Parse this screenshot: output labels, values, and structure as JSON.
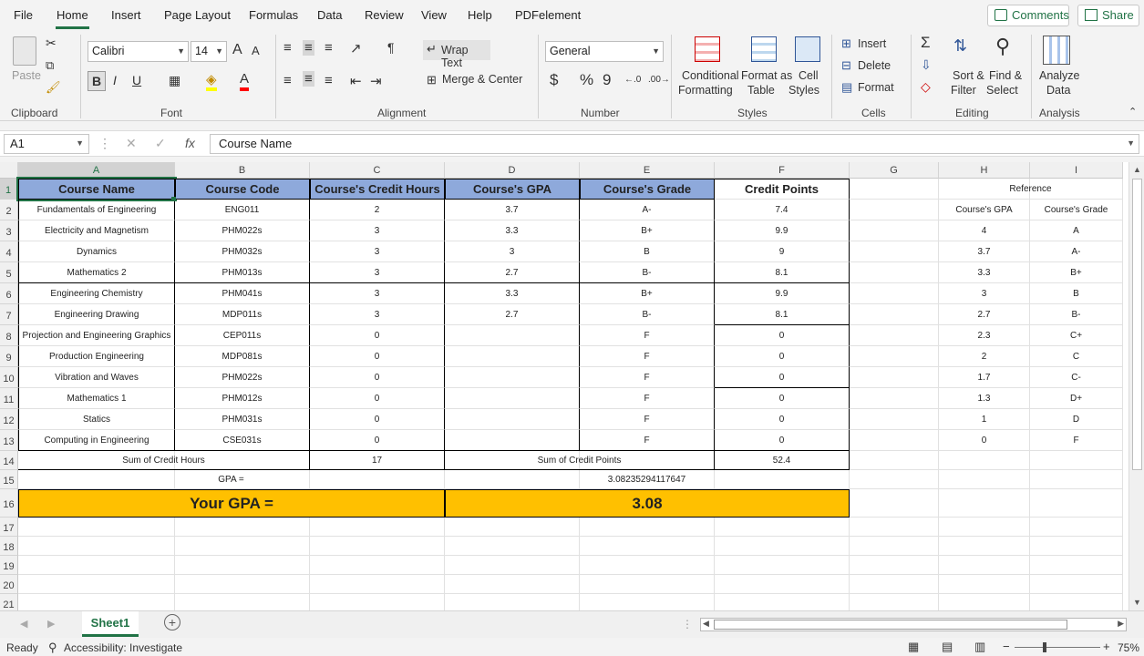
{
  "menu": {
    "items": [
      "File",
      "Home",
      "Insert",
      "Page Layout",
      "Formulas",
      "Data",
      "Review",
      "View",
      "Help",
      "PDFelement"
    ],
    "comments": "Comments",
    "share": "Share"
  },
  "ribbon": {
    "clipboard": {
      "paste": "Paste",
      "label": "Clipboard"
    },
    "font": {
      "name": "Calibri",
      "size": "14",
      "label": "Font",
      "bold": "B",
      "italic": "I",
      "underline": "U",
      "grow": "A",
      "shrink": "A"
    },
    "alignment": {
      "wrap": "Wrap Text",
      "merge": "Merge & Center",
      "label": "Alignment"
    },
    "number": {
      "format": "General",
      "currency": "$",
      "percent": "%",
      "comma": "9",
      "label": "Number"
    },
    "styles": {
      "cond1": "Conditional",
      "cond2": "Formatting",
      "fmt1": "Format as",
      "fmt2": "Table",
      "cell1": "Cell",
      "cell2": "Styles",
      "label": "Styles"
    },
    "cells": {
      "insert": "Insert",
      "delete": "Delete",
      "format": "Format",
      "label": "Cells"
    },
    "editing": {
      "sort1": "Sort &",
      "sort2": "Filter",
      "find1": "Find &",
      "find2": "Select",
      "label": "Editing"
    },
    "analysis": {
      "a1": "Analyze",
      "a2": "Data",
      "label": "Analysis"
    }
  },
  "formula": {
    "namebox": "A1",
    "content": "Course Name",
    "fx": "fx"
  },
  "columns": [
    "A",
    "B",
    "C",
    "D",
    "E",
    "F",
    "G",
    "H",
    "I"
  ],
  "rows": [
    "1",
    "2",
    "3",
    "4",
    "5",
    "6",
    "7",
    "8",
    "9",
    "10",
    "11",
    "12",
    "13",
    "14",
    "15",
    "16",
    "17",
    "18",
    "19",
    "20",
    "21"
  ],
  "table": {
    "headers": [
      "Course Name",
      "Course Code",
      "Course's Credit Hours",
      "Course's GPA",
      "Course's Grade",
      "Credit Points"
    ],
    "rows": [
      [
        "Fundamentals of Engineering",
        "ENG011",
        "2",
        "3.7",
        "A-",
        "7.4"
      ],
      [
        "Electricity and Magnetism",
        "PHM022s",
        "3",
        "3.3",
        "B+",
        "9.9"
      ],
      [
        "Dynamics",
        "PHM032s",
        "3",
        "3",
        "B",
        "9"
      ],
      [
        "Mathematics 2",
        "PHM013s",
        "3",
        "2.7",
        "B-",
        "8.1"
      ],
      [
        "Engineering Chemistry",
        "PHM041s",
        "3",
        "3.3",
        "B+",
        "9.9"
      ],
      [
        "Engineering Drawing",
        "MDP011s",
        "3",
        "2.7",
        "B-",
        "8.1"
      ],
      [
        "Projection and Engineering Graphics",
        "CEP011s",
        "0",
        "",
        "F",
        "0"
      ],
      [
        "Production Engineering",
        "MDP081s",
        "0",
        "",
        "F",
        "0"
      ],
      [
        "Vibration and Waves",
        "PHM022s",
        "0",
        "",
        "F",
        "0"
      ],
      [
        "Mathematics 1",
        "PHM012s",
        "0",
        "",
        "F",
        "0"
      ],
      [
        "Statics",
        "PHM031s",
        "0",
        "",
        "F",
        "0"
      ],
      [
        "Computing in Engineering",
        "CSE031s",
        "0",
        "",
        "F",
        "0"
      ]
    ],
    "sum_hours_label": "Sum of Credit Hours",
    "sum_hours": "17",
    "sum_points_label": "Sum of Credit Points",
    "sum_points": "52.4",
    "gpa_label": "GPA =",
    "gpa_value": "3.08235294117647",
    "your_gpa_label": "Your GPA =",
    "your_gpa": "3.08"
  },
  "reference": {
    "title": "Reference",
    "headers": [
      "Course's GPA",
      "Course's Grade"
    ],
    "rows": [
      [
        "4",
        "A"
      ],
      [
        "3.7",
        "A-"
      ],
      [
        "3.3",
        "B+"
      ],
      [
        "3",
        "B"
      ],
      [
        "2.7",
        "B-"
      ],
      [
        "2.3",
        "C+"
      ],
      [
        "2",
        "C"
      ],
      [
        "1.7",
        "C-"
      ],
      [
        "1.3",
        "D+"
      ],
      [
        "1",
        "D"
      ],
      [
        "0",
        "F"
      ]
    ]
  },
  "sheet_tab": "Sheet1",
  "status": {
    "ready": "Ready",
    "accessibility": "Accessibility: Investigate",
    "zoom": "75%"
  },
  "colors": {
    "accent": "#217346",
    "header_fill": "#8ea9db",
    "gpa_fill": "#ffc000"
  }
}
